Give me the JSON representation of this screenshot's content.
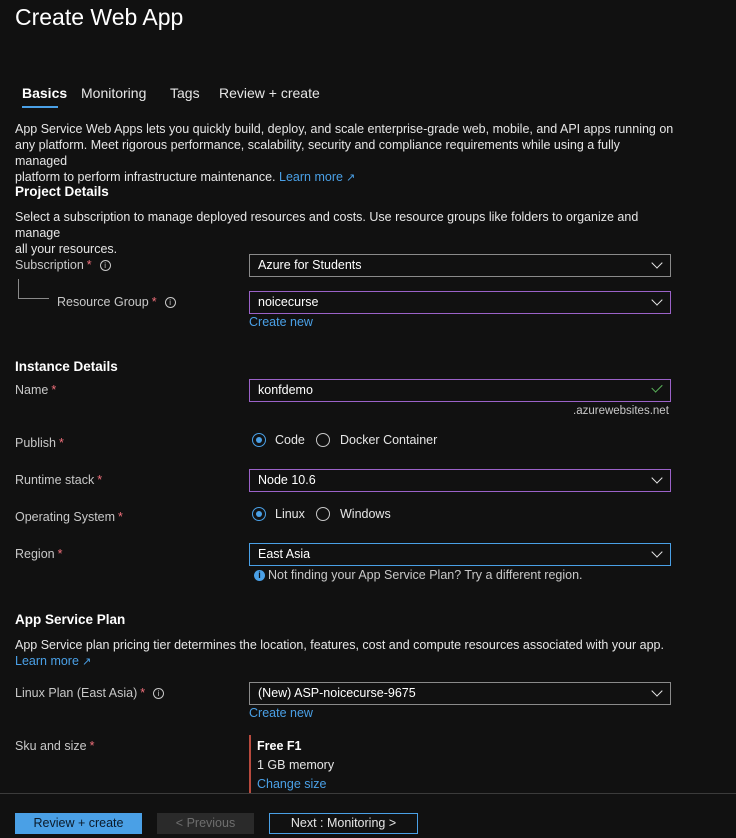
{
  "title": "Create Web App",
  "tabs": [
    "Basics",
    "Monitoring",
    "Tags",
    "Review + create"
  ],
  "intro": {
    "line1": "App Service Web Apps lets you quickly build, deploy, and scale enterprise-grade web, mobile, and API apps running on",
    "line2": "any platform. Meet rigorous performance, scalability, security and compliance requirements while using a fully managed",
    "line3": "platform to perform infrastructure maintenance.",
    "learn_more": "Learn more"
  },
  "project": {
    "heading": "Project Details",
    "desc1": "Select a subscription to manage deployed resources and costs. Use resource groups like folders to organize and manage",
    "desc2": "all your resources.",
    "subscription_label": "Subscription",
    "subscription_value": "Azure for Students",
    "resource_group_label": "Resource Group",
    "resource_group_value": "noicecurse",
    "create_new": "Create new"
  },
  "instance": {
    "heading": "Instance Details",
    "name_label": "Name",
    "name_value": "konfdemo",
    "name_suffix": ".azurewebsites.net",
    "publish_label": "Publish",
    "publish_options": [
      "Code",
      "Docker Container"
    ],
    "publish_selected": "Code",
    "runtime_label": "Runtime stack",
    "runtime_value": "Node 10.6",
    "os_label": "Operating System",
    "os_options": [
      "Linux",
      "Windows"
    ],
    "os_selected": "Linux",
    "region_label": "Region",
    "region_value": "East Asia",
    "region_hint": "Not finding your App Service Plan? Try a different region."
  },
  "plan": {
    "heading": "App Service Plan",
    "desc": "App Service plan pricing tier determines the location, features, cost and compute resources associated with your app.",
    "learn_more": "Learn more",
    "linux_plan_label": "Linux Plan (East Asia)",
    "linux_plan_value": "(New) ASP-noicecurse-9675",
    "create_new": "Create new",
    "sku_label": "Sku and size",
    "sku_name": "Free F1",
    "sku_memory": "1 GB memory",
    "change_size": "Change size"
  },
  "footer": {
    "review_create": "Review + create",
    "previous": "< Previous",
    "next": "Next : Monitoring >"
  },
  "required_mark": "*",
  "colors": {
    "background": "#111111",
    "accent": "#4aa0e6",
    "required": "#f1707b",
    "valid": "#5bb55b",
    "focus_border": "#9b62c8"
  },
  "icons": [
    "info-icon",
    "chevron-down-icon",
    "checkmark-icon",
    "external-link-icon"
  ]
}
